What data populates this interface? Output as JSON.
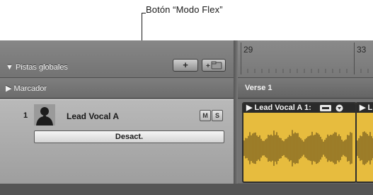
{
  "callout": {
    "label": "Botón “Modo Flex”"
  },
  "global_tracks": {
    "label": "▼ Pistas globales",
    "add_button": "+"
  },
  "marker": {
    "label": "▶ Marcador",
    "lane_label": "Verse 1"
  },
  "ruler": {
    "bars": [
      "29",
      "33"
    ]
  },
  "track": {
    "number": "1",
    "name": "Lead Vocal A",
    "mute_label": "M",
    "solo_label": "S",
    "flex_mode_label": "Desact.",
    "avatar_icon": "singer-silhouette-icon"
  },
  "regions": [
    {
      "title": "▶ Lead Vocal A 1:",
      "icons": [
        "loop-icon",
        "chevron-down-icon"
      ]
    },
    {
      "title": "▶ L",
      "icons": []
    }
  ],
  "colors": {
    "region_fill": "#e7bc3e",
    "region_header": "#2a2a2a",
    "waveform": "#8a6d24"
  }
}
